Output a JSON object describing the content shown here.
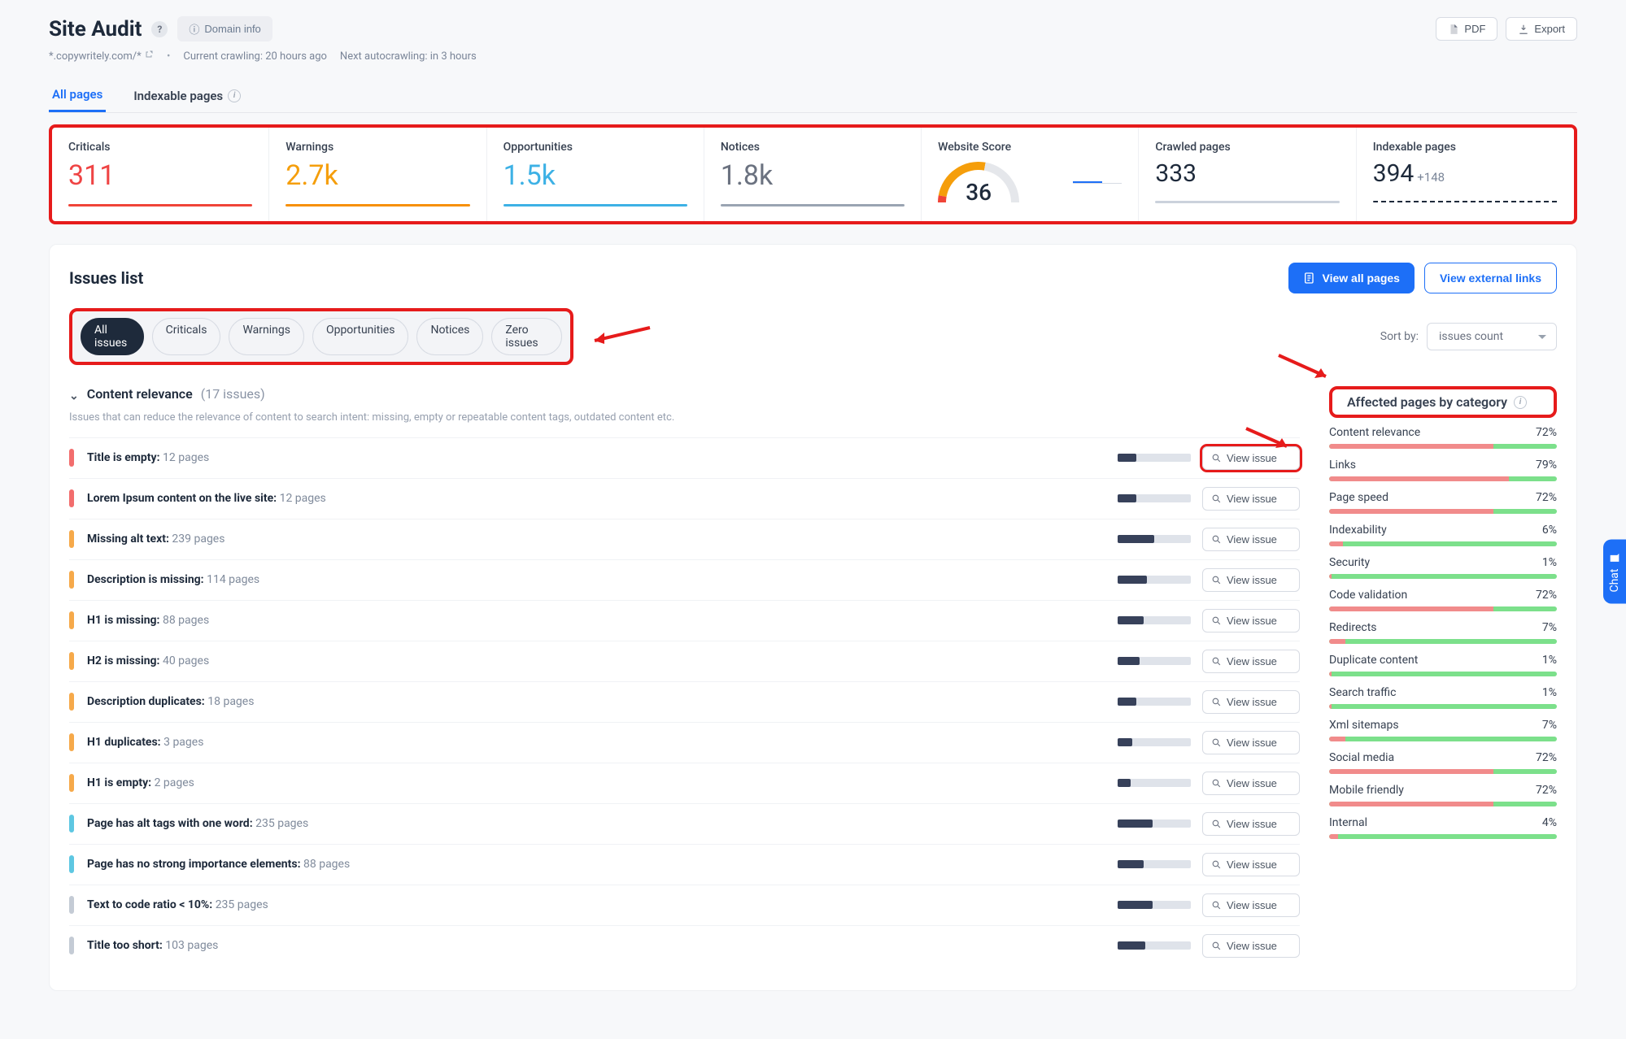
{
  "header": {
    "title": "Site Audit",
    "domain_info_label": "Domain info",
    "pdf_label": "PDF",
    "export_label": "Export"
  },
  "subheader": {
    "domain_pattern": "*.copywritely.com/*",
    "current_crawling": "Current crawling: 20 hours ago",
    "next_autocrawling": "Next autocrawling: in 3 hours"
  },
  "tabs": {
    "all_pages": "All pages",
    "indexable_pages": "Indexable pages"
  },
  "stats": {
    "criticals": {
      "label": "Criticals",
      "value": "311"
    },
    "warnings": {
      "label": "Warnings",
      "value": "2.7k"
    },
    "opportunities": {
      "label": "Opportunities",
      "value": "1.5k"
    },
    "notices": {
      "label": "Notices",
      "value": "1.8k"
    },
    "score": {
      "label": "Website Score",
      "value": "36"
    },
    "crawled": {
      "label": "Crawled pages",
      "value": "333"
    },
    "indexable": {
      "label": "Indexable pages",
      "value": "394",
      "delta": "+148"
    }
  },
  "issues_panel": {
    "title": "Issues list",
    "view_all_pages": "View all pages",
    "view_external_links": "View external links",
    "chips": {
      "all": "All issues",
      "criticals": "Criticals",
      "warnings": "Warnings",
      "opportunities": "Opportunities",
      "notices": "Notices",
      "zero": "Zero issues"
    },
    "sort_label": "Sort by:",
    "sort_value": "issues count",
    "group": {
      "name": "Content relevance",
      "count": "(17 issues)",
      "description": "Issues that can reduce the relevance of content to search intent: missing, empty or repeatable content tags, outdated content etc."
    },
    "view_issue_label": "View issue",
    "issues": [
      {
        "sev": "red",
        "title": "Title is empty:",
        "meta": "12 pages",
        "bar": 25
      },
      {
        "sev": "red",
        "title": "Lorem Ipsum content on the live site:",
        "meta": "12 pages",
        "bar": 25
      },
      {
        "sev": "orange",
        "title": "Missing alt text:",
        "meta": "239 pages",
        "bar": 50
      },
      {
        "sev": "orange",
        "title": "Description is missing:",
        "meta": "114 pages",
        "bar": 40
      },
      {
        "sev": "orange",
        "title": "H1 is missing:",
        "meta": "88 pages",
        "bar": 35
      },
      {
        "sev": "orange",
        "title": "H2 is missing:",
        "meta": "40 pages",
        "bar": 30
      },
      {
        "sev": "orange",
        "title": "Description duplicates:",
        "meta": "18 pages",
        "bar": 25
      },
      {
        "sev": "orange",
        "title": "H1 duplicates:",
        "meta": "3 pages",
        "bar": 20
      },
      {
        "sev": "orange",
        "title": "H1 is empty:",
        "meta": "2 pages",
        "bar": 18
      },
      {
        "sev": "teal",
        "title": "Page has alt tags with one word:",
        "meta": "235 pages",
        "bar": 48
      },
      {
        "sev": "teal",
        "title": "Page has no strong importance elements:",
        "meta": "88 pages",
        "bar": 35
      },
      {
        "sev": "gray",
        "title": "Text to code ratio < 10%:",
        "meta": "235 pages",
        "bar": 48
      },
      {
        "sev": "gray",
        "title": "Title too short:",
        "meta": "103 pages",
        "bar": 38
      }
    ]
  },
  "side": {
    "title": "Affected pages by category",
    "categories": [
      {
        "name": "Content relevance",
        "pct": "72%",
        "bad": 72
      },
      {
        "name": "Links",
        "pct": "79%",
        "bad": 79
      },
      {
        "name": "Page speed",
        "pct": "72%",
        "bad": 72
      },
      {
        "name": "Indexability",
        "pct": "6%",
        "bad": 6
      },
      {
        "name": "Security",
        "pct": "1%",
        "bad": 1
      },
      {
        "name": "Code validation",
        "pct": "72%",
        "bad": 72
      },
      {
        "name": "Redirects",
        "pct": "7%",
        "bad": 7
      },
      {
        "name": "Duplicate content",
        "pct": "1%",
        "bad": 1
      },
      {
        "name": "Search traffic",
        "pct": "1%",
        "bad": 1
      },
      {
        "name": "Xml sitemaps",
        "pct": "7%",
        "bad": 7
      },
      {
        "name": "Social media",
        "pct": "72%",
        "bad": 72
      },
      {
        "name": "Mobile friendly",
        "pct": "72%",
        "bad": 72
      },
      {
        "name": "Internal",
        "pct": "4%",
        "bad": 4
      }
    ]
  },
  "chat": {
    "label": "Chat"
  }
}
